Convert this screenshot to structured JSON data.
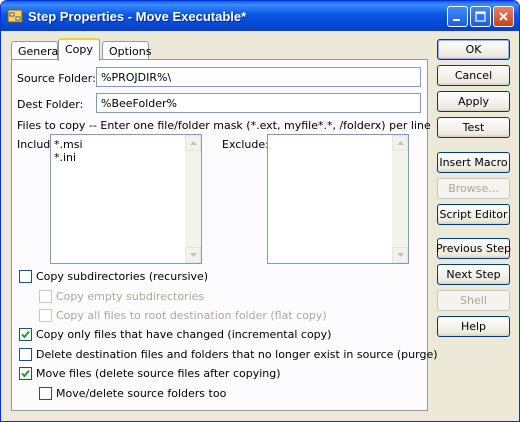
{
  "window": {
    "title": "Step Properties - Move Executable*"
  },
  "tabs": [
    {
      "label": "General"
    },
    {
      "label": "Copy"
    },
    {
      "label": "Options"
    }
  ],
  "form": {
    "source_folder_label": "Source Folder:",
    "source_folder_value": "%PROJDIR%\\",
    "dest_folder_label": "Dest Folder:",
    "dest_folder_value": "%BeeFolder%",
    "files_instruction": "Files to copy -- Enter one file/folder mask (*.ext, myfile*.*, /folderx) per line",
    "include_label": "Include:",
    "include_items": [
      "*.msi",
      "*.ini"
    ],
    "exclude_label": "Exclude:",
    "exclude_items": []
  },
  "options": [
    {
      "label": "Copy subdirectories (recursive)",
      "checked": false,
      "enabled": true
    },
    {
      "label": "Copy empty subdirectories",
      "checked": false,
      "enabled": false
    },
    {
      "label": "Copy all files to root destination folder (flat copy)",
      "checked": false,
      "enabled": false
    },
    {
      "label": "Copy only files that have changed (incremental copy)",
      "checked": true,
      "enabled": true
    },
    {
      "label": "Delete destination files and folders that no longer exist in source (purge)",
      "checked": false,
      "enabled": true
    },
    {
      "label": "Move files (delete source files after copying)",
      "checked": true,
      "enabled": true
    },
    {
      "label": "Move/delete source folders too",
      "checked": false,
      "enabled": true
    }
  ],
  "buttons": {
    "ok": "OK",
    "cancel": "Cancel",
    "apply": "Apply",
    "test": "Test",
    "insert_macro": "Insert Macro",
    "browse": "Browse...",
    "script_editor": "Script Editor",
    "previous_step": "Previous Step",
    "next_step": "Next Step",
    "shell": "Shell",
    "help": "Help"
  },
  "colors": {
    "titlebar": "#0858e4",
    "check_mark": "#21a121",
    "active_tab_accent": "#ffc83c"
  }
}
